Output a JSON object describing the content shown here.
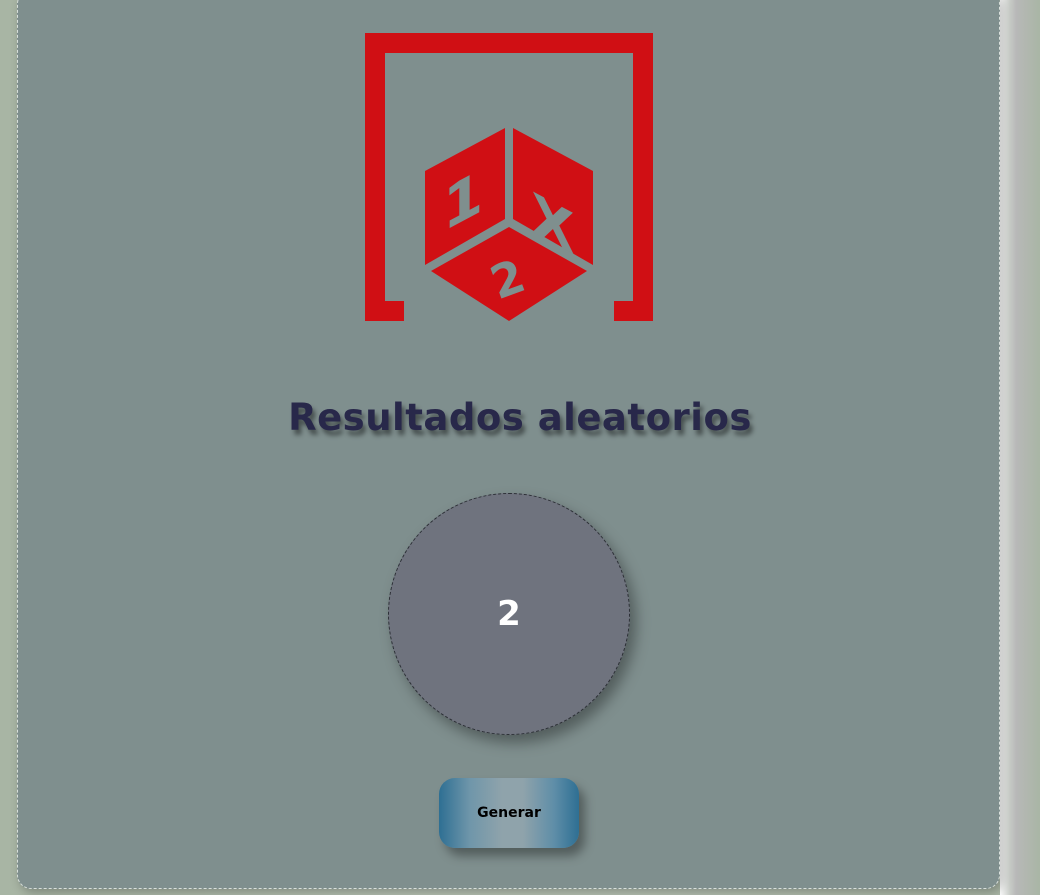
{
  "page": {
    "title": "Resultados aleatorios",
    "result_value": "2",
    "generate_label": "Generar"
  },
  "logo": {
    "face_left": "1",
    "face_right": "X",
    "face_bottom": "2"
  },
  "colors": {
    "logo_red": "#d00f14",
    "card_bg": "#7f8f8e",
    "title": "#28284a",
    "circle": "#6f737e"
  },
  "icons": [
    "dice-1x2-logo-icon"
  ]
}
